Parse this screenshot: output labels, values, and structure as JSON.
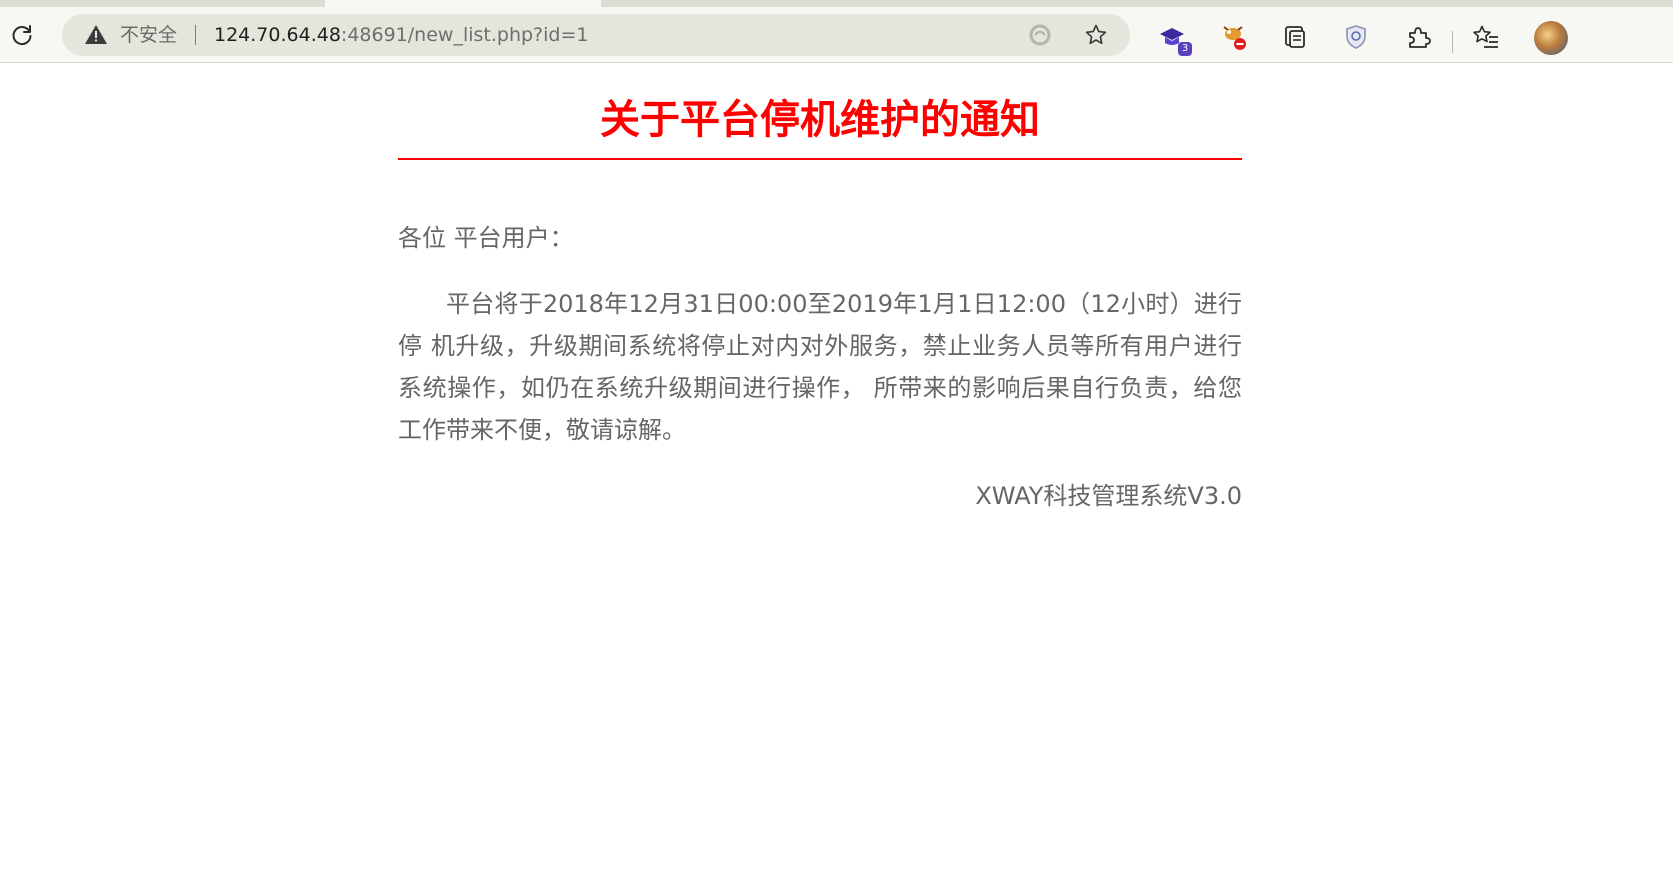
{
  "browser": {
    "security_label": "不安全",
    "url_host": "124.70.64.48",
    "url_rest": ":48691/new_list.php?id=1",
    "extension_badge_count": "3",
    "icons": {
      "reload": "reload-icon",
      "warning": "warning-icon",
      "immersive_reader": "immersive-reader-icon",
      "favorite": "star-icon",
      "extension_1": "graduation-cap-extension-icon",
      "extension_2": "blocked-bug-extension-icon",
      "collections": "collections-icon",
      "shield": "shield-extension-icon",
      "extensions": "puzzle-icon",
      "favorites_bar": "favorites-icon",
      "profile": "profile-avatar"
    }
  },
  "notice": {
    "title": "关于平台停机维护的通知",
    "greeting": "各位 平台用户：",
    "body": "平台将于2018年12月31日00:00至2019年1月1日12:00（12小时）进行停 机升级，升级期间系统将停止对内对外服务，禁止业务人员等所有用户进行系统操作，如仍在系统升级期间进行操作， 所带来的影响后果自行负责，给您工作带来不便，敬请谅解。",
    "signature": "XWAY科技管理系统V3.0"
  },
  "colors": {
    "title_red": "#ff0000",
    "body_text": "#666666",
    "address_bar": "#e5e5dc",
    "toolbar": "#f7f7f3"
  }
}
